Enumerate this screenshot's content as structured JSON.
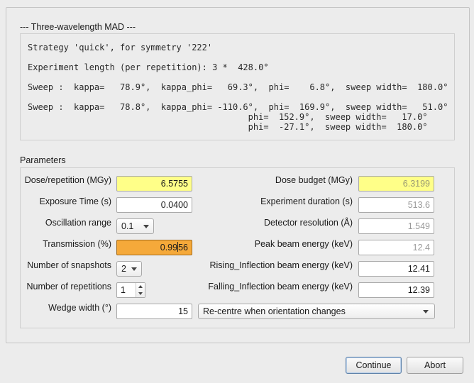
{
  "mad_group": {
    "title": "--- Three-wavelength MAD ---"
  },
  "strategy": {
    "lines": [
      "Strategy 'quick', for symmetry '222'",
      "Experiment length (per repetition): 3 *  428.0°",
      "Sweep :  kappa=   78.9°,  kappa_phi=   69.3°,  phi=    6.8°,  sweep width=  180.0°",
      "Sweep :  kappa=   78.8°,  kappa_phi= -110.6°,  phi=  169.9°,  sweep width=   51.0°",
      "                                           phi=  152.9°,  sweep width=   17.0°",
      "                                           phi=  -27.1°,  sweep width=  180.0°"
    ]
  },
  "params": {
    "title": "Parameters",
    "dose_label": "Dose/repetition (MGy)",
    "dose_value": "6.5755",
    "exposure_label": "Exposure Time (s)",
    "exposure_value": "0.0400",
    "oscillation_label": "Oscillation range",
    "oscillation_value": "0.1",
    "transmission_label": "Transmission (%)",
    "transmission_value_a": "0.99",
    "transmission_value_b": "56",
    "snapshots_label": "Number of snapshots",
    "snapshots_value": "2",
    "repetitions_label": "Number of repetitions",
    "repetitions_value": "1",
    "wedge_label": "Wedge width (°)",
    "wedge_value": "15",
    "dose_budget_label": "Dose budget (MGy)",
    "dose_budget_value": "6.3199",
    "duration_label": "Experiment duration (s)",
    "duration_value": "513.6",
    "resolution_label": "Detector resolution (Å)",
    "resolution_value": "1.549",
    "peak_label": "Peak beam energy (keV)",
    "peak_value": "12.4",
    "rising_label": "Rising_Inflection beam energy (keV)",
    "rising_value": "12.41",
    "falling_label": "Falling_Inflection beam energy (keV)",
    "falling_value": "12.39",
    "recentre_value": "Re-centre when orientation changes"
  },
  "buttons": {
    "continue": "Continue",
    "abort": "Abort"
  },
  "colors": {
    "editable_highlight": "#ffff88",
    "warning_highlight": "#f5a93a",
    "window_background": "#ececec"
  }
}
